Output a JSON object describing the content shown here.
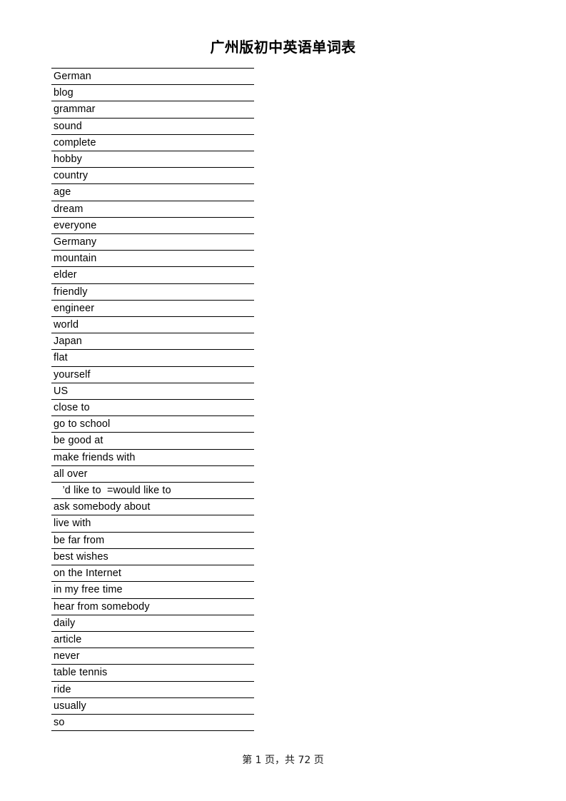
{
  "document": {
    "title": "广州版初中英语单词表"
  },
  "word_table": {
    "rows": [
      {
        "text": "German"
      },
      {
        "text": "blog"
      },
      {
        "text": "grammar"
      },
      {
        "text": "sound"
      },
      {
        "text": "complete"
      },
      {
        "text": "hobby"
      },
      {
        "text": "country"
      },
      {
        "text": "age"
      },
      {
        "text": "dream"
      },
      {
        "text": "everyone"
      },
      {
        "text": "Germany"
      },
      {
        "text": "mountain"
      },
      {
        "text": "elder"
      },
      {
        "text": "friendly"
      },
      {
        "text": "engineer"
      },
      {
        "text": "world"
      },
      {
        "text": "Japan"
      },
      {
        "text": "flat"
      },
      {
        "text": "yourself"
      },
      {
        "text": "US"
      },
      {
        "text": "close to"
      },
      {
        "text": "go to school"
      },
      {
        "text": "be good at"
      },
      {
        "text": "make friends with"
      },
      {
        "text": "all over"
      },
      {
        "text": "   ’d like to  =would like to"
      },
      {
        "text": "ask somebody about"
      },
      {
        "text": "live with"
      },
      {
        "text": "be far from"
      },
      {
        "text": "best wishes"
      },
      {
        "text": "on the Internet"
      },
      {
        "text": "in my free time"
      },
      {
        "text": "hear from somebody"
      },
      {
        "text": "daily"
      },
      {
        "text": "article"
      },
      {
        "text": "never"
      },
      {
        "text": "table tennis"
      },
      {
        "text": "ride"
      },
      {
        "text": "usually"
      },
      {
        "text": "so"
      }
    ]
  },
  "footer": {
    "page_text": "第 1 页，共 72 页",
    "current_page": 1,
    "total_pages": 72
  }
}
